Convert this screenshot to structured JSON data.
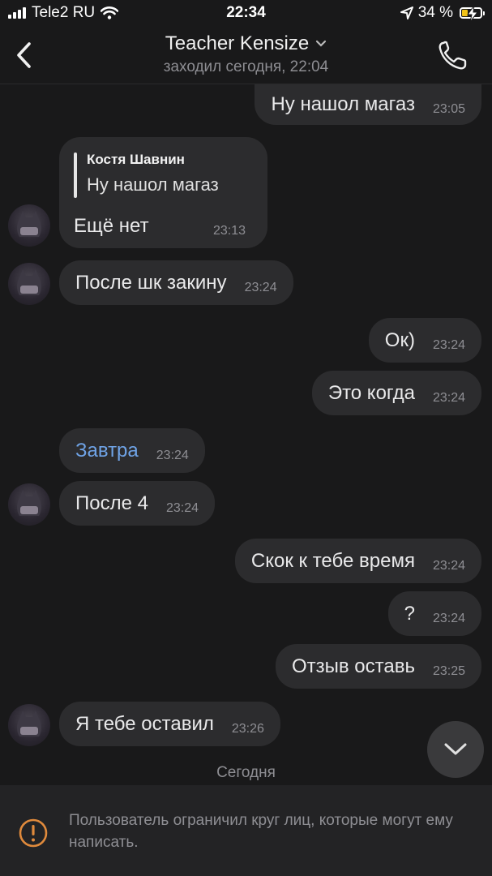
{
  "status_bar": {
    "carrier": "Tele2 RU",
    "time": "22:34",
    "battery_percent": "34 %",
    "battery_level": 0.34,
    "charging": true
  },
  "header": {
    "title": "Teacher Kensize",
    "subtitle": "заходил сегодня, 22:04",
    "back_icon": "chevron-left-icon",
    "call_icon": "phone-icon"
  },
  "messages": [
    {
      "direction": "outgoing",
      "text": "Ну нашол магаз",
      "time": "23:05"
    },
    {
      "direction": "incoming",
      "reply_to": {
        "name": "Костя Шавнин",
        "text": "Ну нашол магаз"
      },
      "text": "Ещё нет",
      "time": "23:13"
    },
    {
      "direction": "incoming",
      "text": "После шк закину",
      "time": "23:24"
    },
    {
      "direction": "outgoing",
      "text": "Ок)",
      "time": "23:24"
    },
    {
      "direction": "outgoing",
      "text": "Это когда",
      "time": "23:24"
    },
    {
      "direction": "incoming",
      "text": "Завтра",
      "time": "23:24",
      "style": "link"
    },
    {
      "direction": "incoming",
      "text": "После 4",
      "time": "23:24"
    },
    {
      "direction": "outgoing",
      "text": "Скок к тебе время",
      "time": "23:24"
    },
    {
      "direction": "outgoing",
      "text": "?",
      "time": "23:24"
    },
    {
      "direction": "outgoing",
      "text": "Отзыв оставь",
      "time": "23:25"
    },
    {
      "direction": "incoming",
      "text": "Я тебе оставил",
      "time": "23:26"
    }
  ],
  "date_separator": "Сегодня",
  "footer": {
    "notice": "Пользователь ограничил круг лиц, которые могут ему написать."
  },
  "colors": {
    "background": "#19191a",
    "bubble": "#2c2c2e",
    "link": "#6fa3e6",
    "warning": "#e08a3c",
    "battery": "#f2c317"
  }
}
